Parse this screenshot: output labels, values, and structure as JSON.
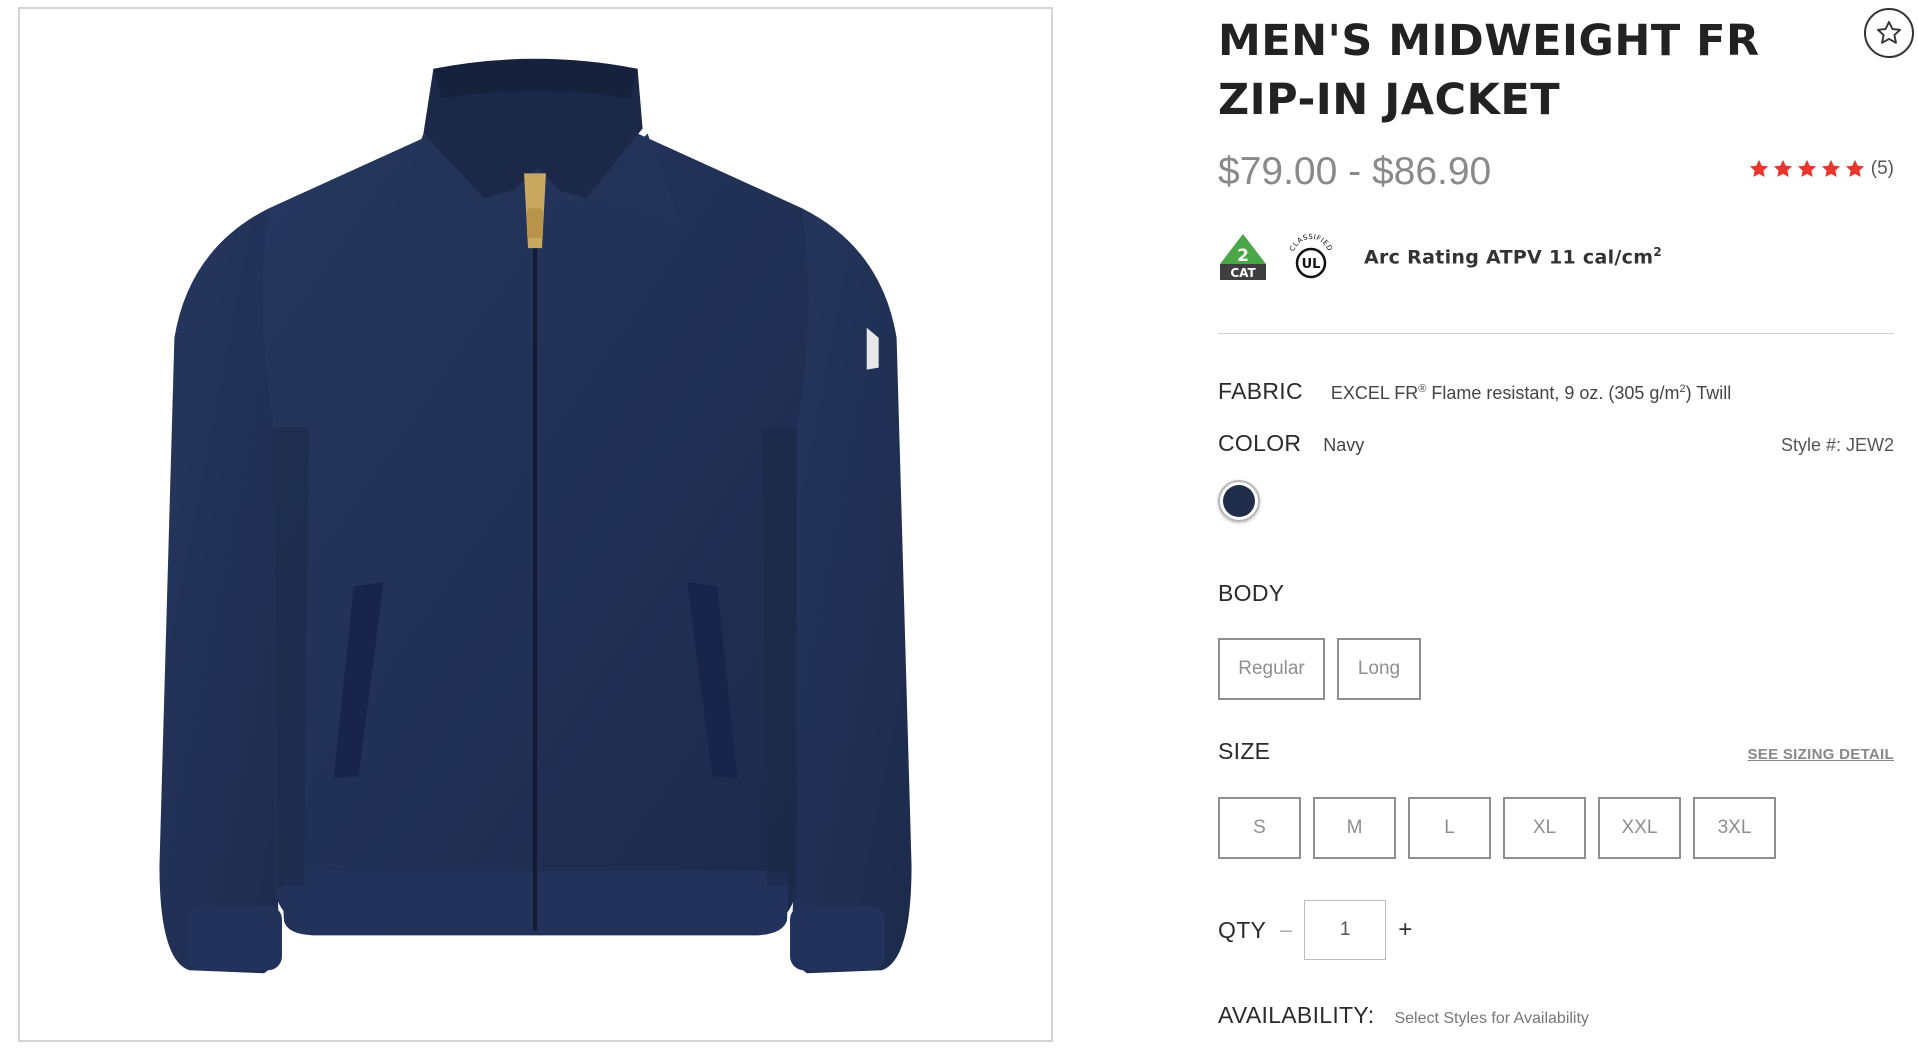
{
  "product": {
    "title": "MEN'S MIDWEIGHT FR ZIP-IN JACKET",
    "price": "$79.00 - $86.90",
    "rating": 5,
    "rating_max": 5,
    "review_count": "(5)",
    "star_color": "#e8352e",
    "arc_rating_text": "Arc Rating ATPV 11 cal/cm",
    "arc_rating_sup": "2",
    "badges": {
      "cat_number": "2",
      "cat_label": "CAT",
      "ul_mark": "UL",
      "ul_classified": "CLASSIFIED"
    }
  },
  "fabric": {
    "label": "FABRIC",
    "value_prefix": "EXCEL FR",
    "value_reg": "®",
    "value_mid": " Flame resistant, 9 oz. (305 g/m",
    "value_sup": "2",
    "value_suffix": ") Twill"
  },
  "color": {
    "label": "COLOR",
    "value": "Navy",
    "swatch_hex": "#1f2d4a",
    "style_number": "Style #: JEW2"
  },
  "body": {
    "label": "BODY",
    "options": [
      "Regular",
      "Long"
    ]
  },
  "size": {
    "label": "SIZE",
    "sizing_link": "SEE SIZING DETAIL",
    "options": [
      "S",
      "M",
      "L",
      "XL",
      "XXL",
      "3XL"
    ]
  },
  "qty": {
    "label": "QTY",
    "minus": "–",
    "value": "1",
    "plus": "+"
  },
  "availability": {
    "label": "AVAILABILITY:",
    "value": "Select Styles for Availability"
  }
}
